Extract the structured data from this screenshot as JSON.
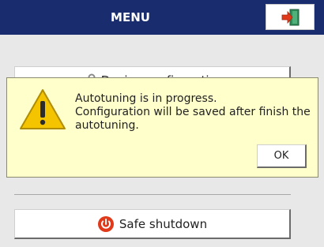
{
  "header": {
    "title": "MENU",
    "exit_icon": "exit-door-icon"
  },
  "menu": {
    "device_config_label": "Device configuration",
    "safe_shutdown_label": "Safe shutdown",
    "device_config_icon": "tools-icon",
    "safe_shutdown_icon": "power-icon"
  },
  "dialog": {
    "line1": "Autotuning is in progress.",
    "line2": "Configuration will be saved after finish the autotuning.",
    "ok_label": "OK",
    "icon": "warning-icon"
  },
  "colors": {
    "header_bg": "#192d6e",
    "dialog_bg": "#ffffcc",
    "power_red": "#e03a1a",
    "warning_yellow": "#f5c400"
  }
}
